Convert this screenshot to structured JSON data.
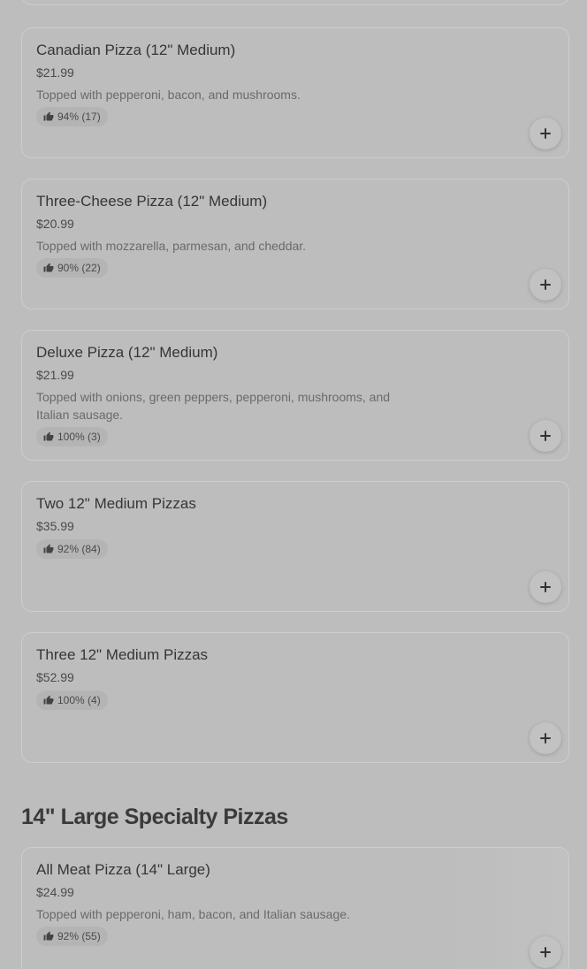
{
  "items": [
    {
      "title": "Canadian Pizza (12\" Medium)",
      "price": "$21.99",
      "description": "Topped with pepperoni, bacon, and mushrooms.",
      "rating": "94% (17)"
    },
    {
      "title": "Three-Cheese Pizza (12\" Medium)",
      "price": "$20.99",
      "description": "Topped with mozzarella, parmesan, and cheddar.",
      "rating": "90% (22)"
    },
    {
      "title": "Deluxe Pizza (12\" Medium)",
      "price": "$21.99",
      "description": "Topped with onions, green peppers, pepperoni, mushrooms, and Italian sausage.",
      "rating": "100% (3)"
    },
    {
      "title": "Two 12\" Medium Pizzas",
      "price": "$35.99",
      "description": "",
      "rating": "92% (84)"
    },
    {
      "title": "Three 12\" Medium Pizzas",
      "price": "$52.99",
      "description": "",
      "rating": "100% (4)"
    }
  ],
  "section": {
    "heading": "14\" Large Specialty Pizzas",
    "items": [
      {
        "title": "All Meat Pizza (14\" Large)",
        "price": "$24.99",
        "description": "Topped with pepperoni, ham, bacon, and Italian sausage.",
        "rating": "92% (55)"
      }
    ]
  },
  "icons": {
    "rating": "thumbs-up-icon",
    "add": "plus-icon"
  }
}
